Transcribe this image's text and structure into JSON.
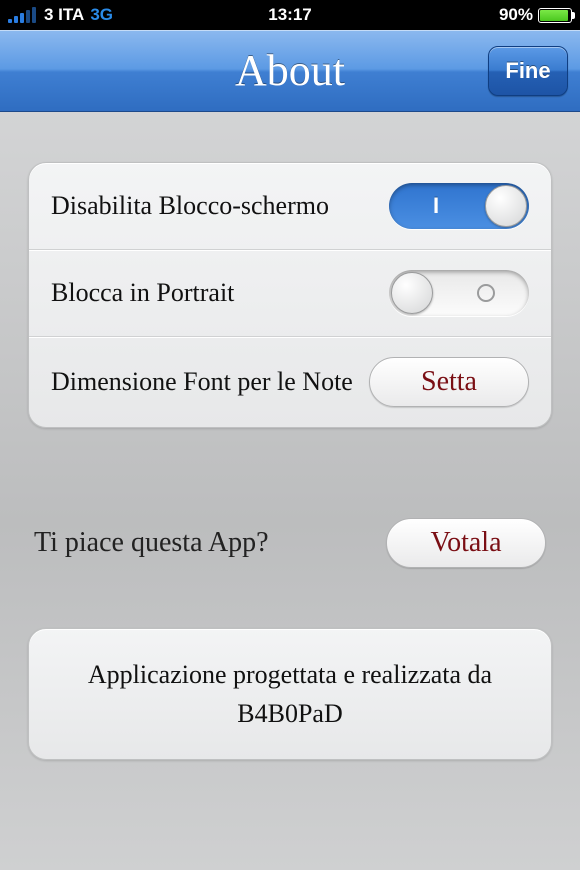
{
  "status": {
    "carrier": "3 ITA",
    "network": "3G",
    "time": "13:17",
    "battery_pct": "90%"
  },
  "nav": {
    "title": "About",
    "done": "Fine"
  },
  "settings": {
    "disable_screen_lock": {
      "label": "Disabilita Blocco-schermo",
      "value": true
    },
    "lock_portrait": {
      "label": "Blocca in Portrait",
      "value": false
    },
    "font_size": {
      "label": "Dimensione Font per le Note",
      "button": "Setta"
    }
  },
  "rate": {
    "prompt": "Ti piace questa App?",
    "button": "Votala"
  },
  "credits": {
    "line1": "Applicazione progettata e realizzata da",
    "line2": "B4B0PaD"
  }
}
